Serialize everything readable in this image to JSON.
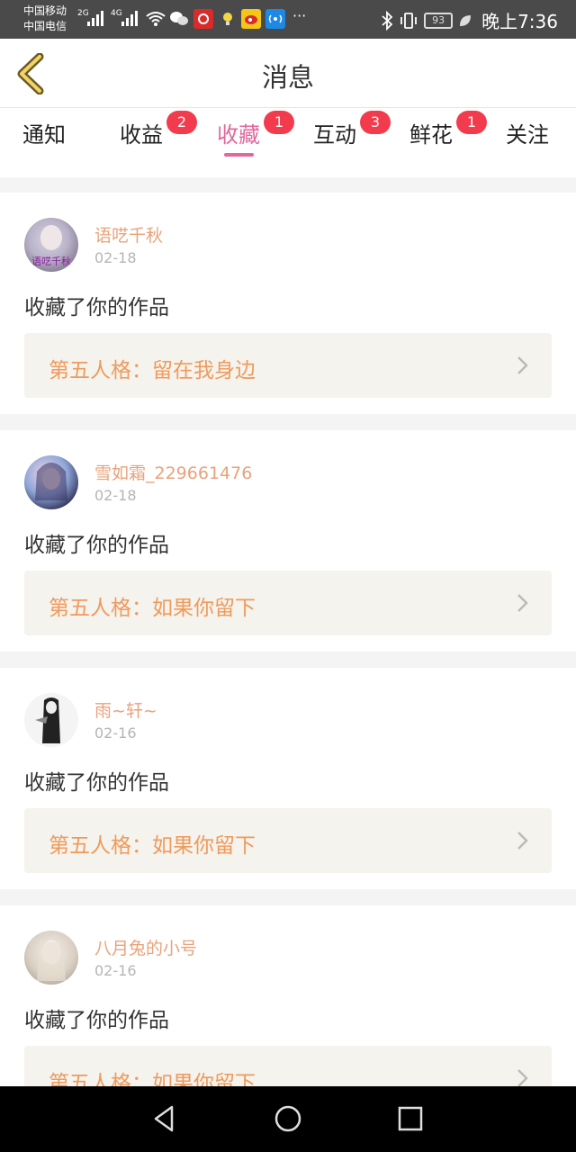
{
  "status_bar": {
    "carrier_1": "中国移动",
    "carrier_2": "中国电信",
    "net_1": "2G",
    "net_2": "4G",
    "more": "···",
    "battery": "93",
    "time": "晚上7:36"
  },
  "header": {
    "title": "消息"
  },
  "tabs": [
    {
      "label": "通知",
      "badge": ""
    },
    {
      "label": "收益",
      "badge": "2"
    },
    {
      "label": "收藏",
      "badge": "1",
      "active": true
    },
    {
      "label": "互动",
      "badge": "3"
    },
    {
      "label": "鲜花",
      "badge": "1"
    },
    {
      "label": "关注",
      "badge": ""
    }
  ],
  "messages": [
    {
      "name": "语呓千秋",
      "date": "02-18",
      "action": "收藏了你的作品",
      "work": "第五人格：留在我身边",
      "avatar_text": "语呓千秋"
    },
    {
      "name": "雪如霜_229661476",
      "date": "02-18",
      "action": "收藏了你的作品",
      "work": "第五人格：如果你留下"
    },
    {
      "name": "雨~轩~",
      "date": "02-16",
      "action": "收藏了你的作品",
      "work": "第五人格：如果你留下"
    },
    {
      "name": "八月兔的小号",
      "date": "02-16",
      "action": "收藏了你的作品",
      "work": "第五人格：如果你留下"
    }
  ],
  "colors": {
    "accent_pink": "#e0689b",
    "badge_red": "#f23c4e",
    "name_orange": "#e8a27a",
    "work_orange": "#f09a5c"
  },
  "icons": [
    "back-arrow-icon",
    "chevron-right-icon",
    "nav-back-icon",
    "nav-home-icon",
    "nav-recent-icon"
  ]
}
